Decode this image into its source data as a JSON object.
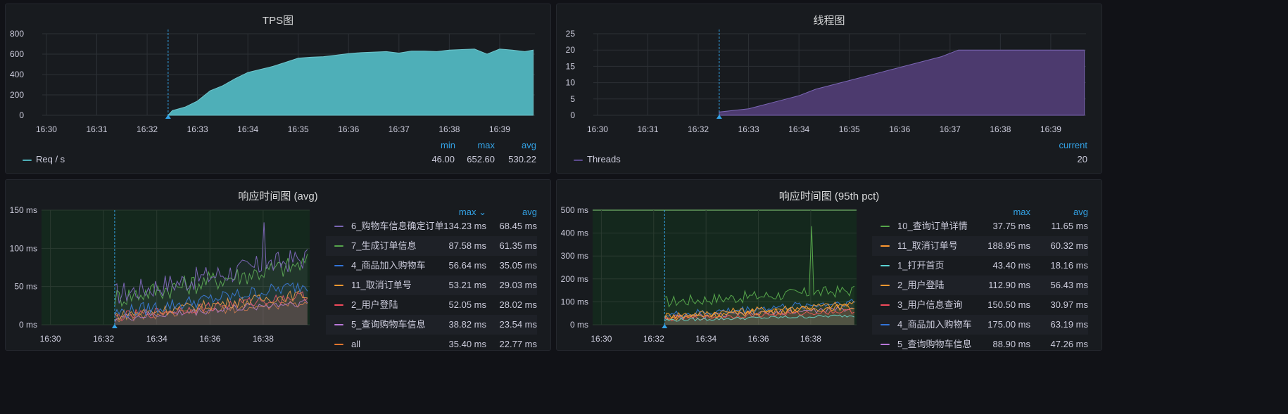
{
  "panels": {
    "tps": {
      "title": "TPS图",
      "legend": {
        "headers": {
          "min": "min",
          "max": "max",
          "avg": "avg"
        },
        "series_name": "Req / s",
        "min": "46.00",
        "max": "652.60",
        "avg": "530.22"
      }
    },
    "threads": {
      "title": "线程图",
      "legend": {
        "headers": {
          "current": "current"
        },
        "series_name": "Threads",
        "current": "20"
      }
    },
    "rt_avg": {
      "title": "响应时间图 (avg)",
      "table": {
        "headers": {
          "max": "max ⌄",
          "avg": "avg"
        },
        "rows": [
          {
            "name": "6_购物车信息确定订单",
            "max": "134.23 ms",
            "avg": "68.45 ms"
          },
          {
            "name": "7_生成订单信息",
            "max": "87.58 ms",
            "avg": "61.35 ms"
          },
          {
            "name": "4_商品加入购物车",
            "max": "56.64 ms",
            "avg": "35.05 ms"
          },
          {
            "name": "11_取消订单号",
            "max": "53.21 ms",
            "avg": "29.03 ms"
          },
          {
            "name": "2_用户登陆",
            "max": "52.05 ms",
            "avg": "28.02 ms"
          },
          {
            "name": "5_查询购物车信息",
            "max": "38.82 ms",
            "avg": "23.54 ms"
          },
          {
            "name": "all",
            "max": "35.40 ms",
            "avg": "22.77 ms"
          }
        ]
      }
    },
    "rt_p95": {
      "title": "响应时间图 (95th pct)",
      "table": {
        "headers": {
          "max": "max",
          "avg": "avg"
        },
        "rows": [
          {
            "name": "10_查询订单详情",
            "max": "37.75 ms",
            "avg": "11.65 ms"
          },
          {
            "name": "11_取消订单号",
            "max": "188.95 ms",
            "avg": "60.32 ms"
          },
          {
            "name": "1_打开首页",
            "max": "43.40 ms",
            "avg": "18.16 ms"
          },
          {
            "name": "2_用户登陆",
            "max": "112.90 ms",
            "avg": "56.43 ms"
          },
          {
            "name": "3_用户信息查询",
            "max": "150.50 ms",
            "avg": "30.97 ms"
          },
          {
            "name": "4_商品加入购物车",
            "max": "175.00 ms",
            "avg": "63.19 ms"
          },
          {
            "name": "5_查询购物车信息",
            "max": "88.90 ms",
            "avg": "47.26 ms"
          }
        ]
      }
    }
  },
  "colors": {
    "tps_fill": "#4eafb8",
    "threads_fill": "#4c3a6e",
    "grid": "#2c3035",
    "axis_text": "#ccccdc",
    "threshold_green": "#73bf69",
    "legend_blue": "#33a2e5",
    "cursor": "#33a2e5",
    "series": [
      "#7b66b5",
      "#56a64b",
      "#3274d9",
      "#ff9830",
      "#f2495c",
      "#b877d9",
      "#e0752d",
      "#8ab8ff",
      "#fade2a"
    ],
    "p95_series": [
      "#56a64b",
      "#ff9830",
      "#5ad3d3",
      "#ff9830",
      "#f2495c",
      "#3274d9",
      "#b877d9"
    ]
  },
  "chart_data": [
    {
      "type": "area",
      "title": "TPS图",
      "x": [
        "16:30",
        "16:31",
        "16:32",
        "16:33",
        "16:34",
        "16:35",
        "16:36",
        "16:37",
        "16:38",
        "16:39"
      ],
      "y_ticks": [
        "0",
        "200",
        "400",
        "600",
        "800"
      ],
      "ylim": [
        0,
        800
      ],
      "series": [
        {
          "name": "Req / s",
          "points": [
            [
              "16:32:25",
              0
            ],
            [
              "16:32:30",
              46
            ],
            [
              "16:32:45",
              80
            ],
            [
              "16:33:00",
              140
            ],
            [
              "16:33:15",
              240
            ],
            [
              "16:33:30",
              290
            ],
            [
              "16:33:45",
              360
            ],
            [
              "16:34:00",
              420
            ],
            [
              "16:34:15",
              450
            ],
            [
              "16:34:30",
              480
            ],
            [
              "16:34:45",
              520
            ],
            [
              "16:35:00",
              560
            ],
            [
              "16:35:15",
              570
            ],
            [
              "16:35:30",
              575
            ],
            [
              "16:35:45",
              590
            ],
            [
              "16:36:00",
              605
            ],
            [
              "16:36:15",
              615
            ],
            [
              "16:36:30",
              620
            ],
            [
              "16:36:45",
              625
            ],
            [
              "16:37:00",
              610
            ],
            [
              "16:37:15",
              630
            ],
            [
              "16:37:30",
              630
            ],
            [
              "16:37:45",
              625
            ],
            [
              "16:38:00",
              640
            ],
            [
              "16:38:15",
              645
            ],
            [
              "16:38:30",
              650
            ],
            [
              "16:38:45",
              600
            ],
            [
              "16:39:00",
              650
            ],
            [
              "16:39:15",
              640
            ],
            [
              "16:39:30",
              625
            ],
            [
              "16:39:40",
              640
            ]
          ]
        }
      ]
    },
    {
      "type": "area",
      "title": "线程图",
      "x": [
        "16:30",
        "16:31",
        "16:32",
        "16:33",
        "16:34",
        "16:35",
        "16:36",
        "16:37",
        "16:38",
        "16:39"
      ],
      "y_ticks": [
        "0",
        "5",
        "10",
        "15",
        "20",
        "25"
      ],
      "ylim": [
        0,
        25
      ],
      "series": [
        {
          "name": "Threads",
          "points": [
            [
              "16:32:25",
              1
            ],
            [
              "16:33:00",
              2
            ],
            [
              "16:33:15",
              3
            ],
            [
              "16:33:30",
              4
            ],
            [
              "16:33:45",
              5
            ],
            [
              "16:34:00",
              6
            ],
            [
              "16:34:10",
              7
            ],
            [
              "16:34:20",
              8
            ],
            [
              "16:34:35",
              9
            ],
            [
              "16:34:50",
              10
            ],
            [
              "16:35:05",
              11
            ],
            [
              "16:35:20",
              12
            ],
            [
              "16:35:35",
              13
            ],
            [
              "16:35:50",
              14
            ],
            [
              "16:36:05",
              15
            ],
            [
              "16:36:20",
              16
            ],
            [
              "16:36:35",
              17
            ],
            [
              "16:36:50",
              18
            ],
            [
              "16:37:00",
              19
            ],
            [
              "16:37:10",
              20
            ],
            [
              "16:39:40",
              20
            ]
          ]
        }
      ]
    },
    {
      "type": "line",
      "title": "响应时间图 (avg)",
      "x": [
        "16:30",
        "16:32",
        "16:34",
        "16:36",
        "16:38"
      ],
      "y_ticks": [
        "0 ms",
        "50 ms",
        "100 ms",
        "150 ms"
      ],
      "ylim": [
        0,
        150
      ],
      "series": [
        {
          "name": "6_购物车信息确定订单",
          "start": 40,
          "end": 88,
          "spike": 134
        },
        {
          "name": "7_生成订单信息",
          "start": 35,
          "end": 80
        },
        {
          "name": "4_商品加入购物车",
          "start": 15,
          "end": 52
        },
        {
          "name": "11_取消订单号",
          "start": 12,
          "end": 40
        },
        {
          "name": "2_用户登陆",
          "start": 10,
          "end": 38
        },
        {
          "name": "5_查询购物车信息",
          "start": 8,
          "end": 30
        },
        {
          "name": "all",
          "start": 8,
          "end": 28
        }
      ]
    },
    {
      "type": "line",
      "title": "响应时间图 (95th pct)",
      "x": [
        "16:30",
        "16:32",
        "16:34",
        "16:36",
        "16:38"
      ],
      "y_ticks": [
        "0 ms",
        "100 ms",
        "200 ms",
        "300 ms",
        "400 ms",
        "500 ms"
      ],
      "ylim": [
        0,
        500
      ],
      "series": [
        {
          "name": "10_查询订单详情",
          "start": 100,
          "end": 150,
          "spike": 430
        },
        {
          "name": "11_取消订单号",
          "start": 40,
          "end": 90
        },
        {
          "name": "1_打开首页",
          "start": 20,
          "end": 40
        },
        {
          "name": "2_用户登陆",
          "start": 30,
          "end": 80
        },
        {
          "name": "3_用户信息查询",
          "start": 25,
          "end": 60
        },
        {
          "name": "4_商品加入购物车",
          "start": 40,
          "end": 100
        },
        {
          "name": "5_查询购物车信息",
          "start": 30,
          "end": 70
        }
      ]
    }
  ]
}
